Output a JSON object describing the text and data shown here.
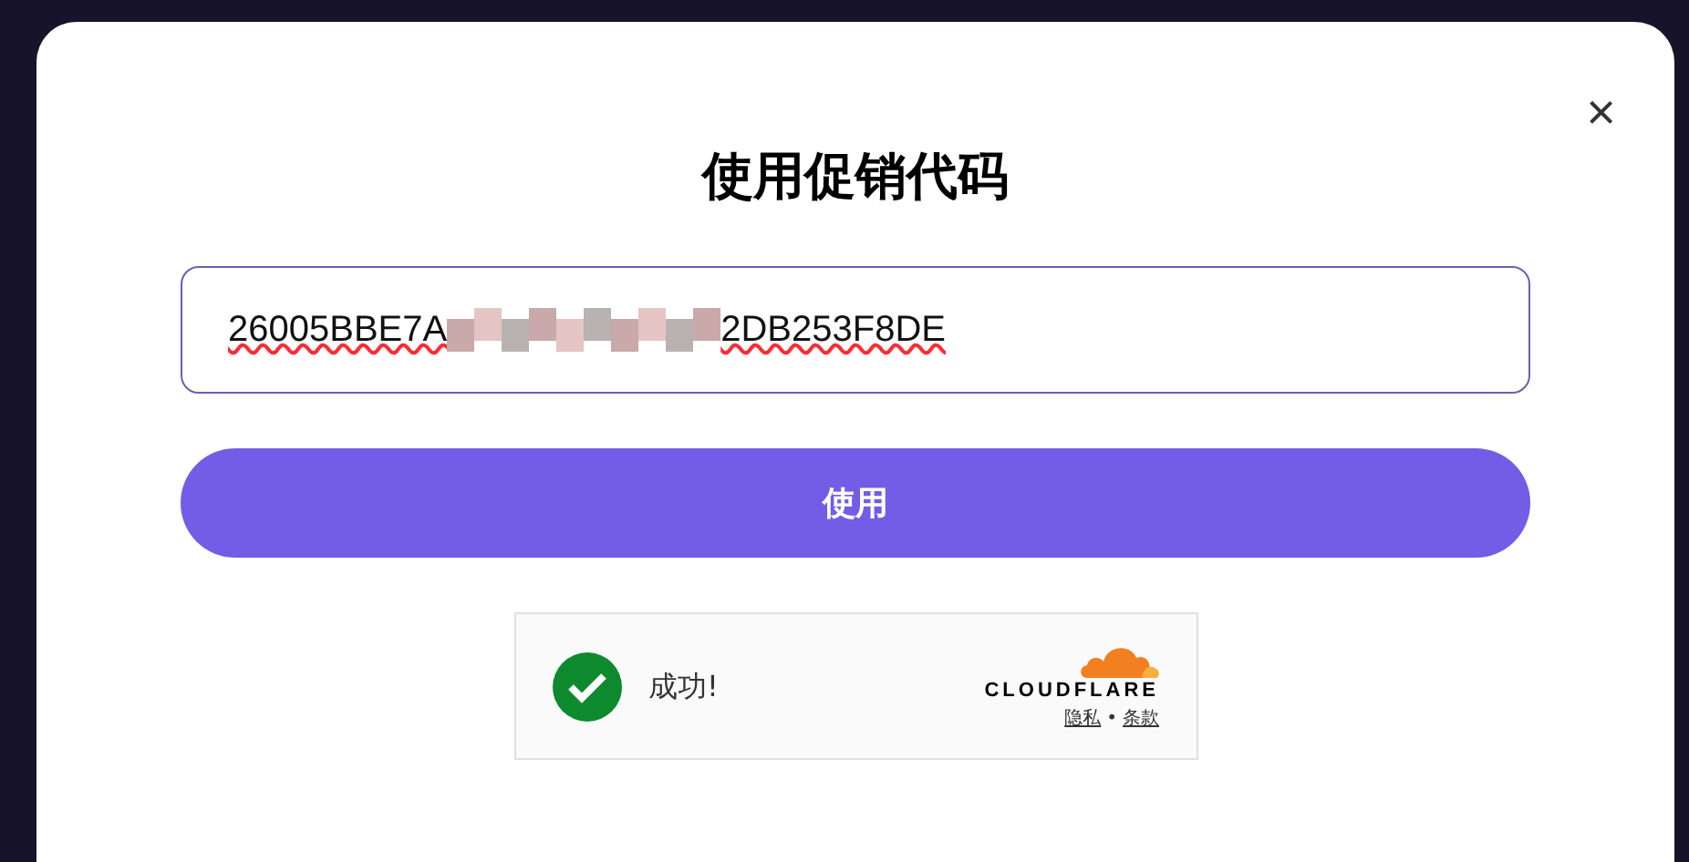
{
  "dialog": {
    "title": "使用促销代码",
    "close_label": "×"
  },
  "promo_field": {
    "value_start": "26005BBE7A",
    "value_end": "2DB253F8DE",
    "redacted": true
  },
  "apply_button": {
    "label": "使用"
  },
  "captcha": {
    "status": "成功!",
    "verified": true,
    "brand": "CLOUDFLARE",
    "links": [
      {
        "label": "隐私"
      },
      {
        "label": "条款"
      }
    ],
    "separator": "•"
  }
}
